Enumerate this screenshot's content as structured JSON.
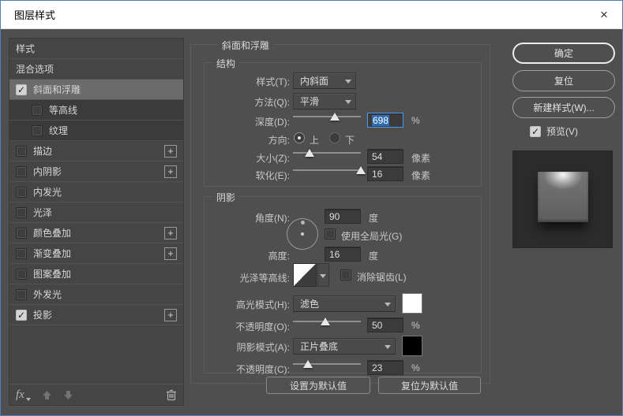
{
  "window": {
    "title": "图层样式",
    "close_glyph": "×"
  },
  "sidebar": {
    "items": [
      {
        "label": "样式",
        "checked": null,
        "selected": false,
        "plus": false,
        "sub": false
      },
      {
        "label": "混合选项",
        "checked": null,
        "selected": false,
        "plus": false,
        "sub": false
      },
      {
        "label": "斜面和浮雕",
        "checked": true,
        "selected": true,
        "plus": false,
        "sub": false
      },
      {
        "label": "等高线",
        "checked": false,
        "selected": false,
        "plus": false,
        "sub": true
      },
      {
        "label": "纹理",
        "checked": false,
        "selected": false,
        "plus": false,
        "sub": true
      },
      {
        "label": "描边",
        "checked": false,
        "selected": false,
        "plus": true,
        "sub": false
      },
      {
        "label": "内阴影",
        "checked": false,
        "selected": false,
        "plus": true,
        "sub": false
      },
      {
        "label": "内发光",
        "checked": false,
        "selected": false,
        "plus": false,
        "sub": false
      },
      {
        "label": "光泽",
        "checked": false,
        "selected": false,
        "plus": false,
        "sub": false
      },
      {
        "label": "颜色叠加",
        "checked": false,
        "selected": false,
        "plus": true,
        "sub": false
      },
      {
        "label": "渐变叠加",
        "checked": false,
        "selected": false,
        "plus": true,
        "sub": false
      },
      {
        "label": "图案叠加",
        "checked": false,
        "selected": false,
        "plus": false,
        "sub": false
      },
      {
        "label": "外发光",
        "checked": false,
        "selected": false,
        "plus": false,
        "sub": false
      },
      {
        "label": "投影",
        "checked": true,
        "selected": false,
        "plus": true,
        "sub": false
      }
    ],
    "check_glyph": "✓",
    "plus_glyph": "+",
    "footer": {
      "fx_label": "fx"
    }
  },
  "panel": {
    "heading": "斜面和浮雕",
    "structure": {
      "legend": "结构",
      "style_label": "样式(T):",
      "style_value": "内斜面",
      "method_label": "方法(Q):",
      "method_value": "平滑",
      "depth_label": "深度(D):",
      "depth_value": "698",
      "depth_unit": "%",
      "depth_percent": 62,
      "direction_label": "方向:",
      "dir_up": "上",
      "dir_down": "下",
      "size_label": "大小(Z):",
      "size_value": "54",
      "size_unit": "像素",
      "size_percent": 24,
      "soften_label": "软化(E):",
      "soften_value": "16",
      "soften_unit": "像素",
      "soften_percent": 100
    },
    "shading": {
      "legend": "阴影",
      "angle_label": "角度(N):",
      "angle_value": "90",
      "angle_unit": "度",
      "global_light_label": "使用全局光(G)",
      "altitude_label": "高度:",
      "altitude_value": "16",
      "altitude_unit": "度",
      "gloss_label": "光泽等高线:",
      "antialias_label": "消除锯齿(L)",
      "highlight_mode_label": "高光模式(H):",
      "highlight_mode_value": "滤色",
      "highlight_color": "#ffffff",
      "highlight_opacity_label": "不透明度(O):",
      "highlight_opacity_value": "50",
      "highlight_opacity_unit": "%",
      "highlight_opacity_percent": 48,
      "shadow_mode_label": "阴影模式(A):",
      "shadow_mode_value": "正片叠底",
      "shadow_color": "#000000",
      "shadow_opacity_label": "不透明度(C):",
      "shadow_opacity_value": "23",
      "shadow_opacity_unit": "%",
      "shadow_opacity_percent": 22
    },
    "footer_buttons": {
      "set_default": "设置为默认值",
      "reset_default": "复位为默认值"
    }
  },
  "actions": {
    "ok": "确定",
    "reset": "复位",
    "new_style": "新建样式(W)...",
    "preview_label": "预览(V)",
    "preview_checked": true
  },
  "colors": {
    "dialog_bg": "#4f4f4f",
    "sidebar_bg": "#454545",
    "selected_row": "#6b6b6b",
    "selection_blue": "#2f6cb3",
    "focus_border": "#4d9aef",
    "window_border": "#4a82b8",
    "highlight_swatch": "#ffffff",
    "shadow_swatch": "#000000"
  }
}
